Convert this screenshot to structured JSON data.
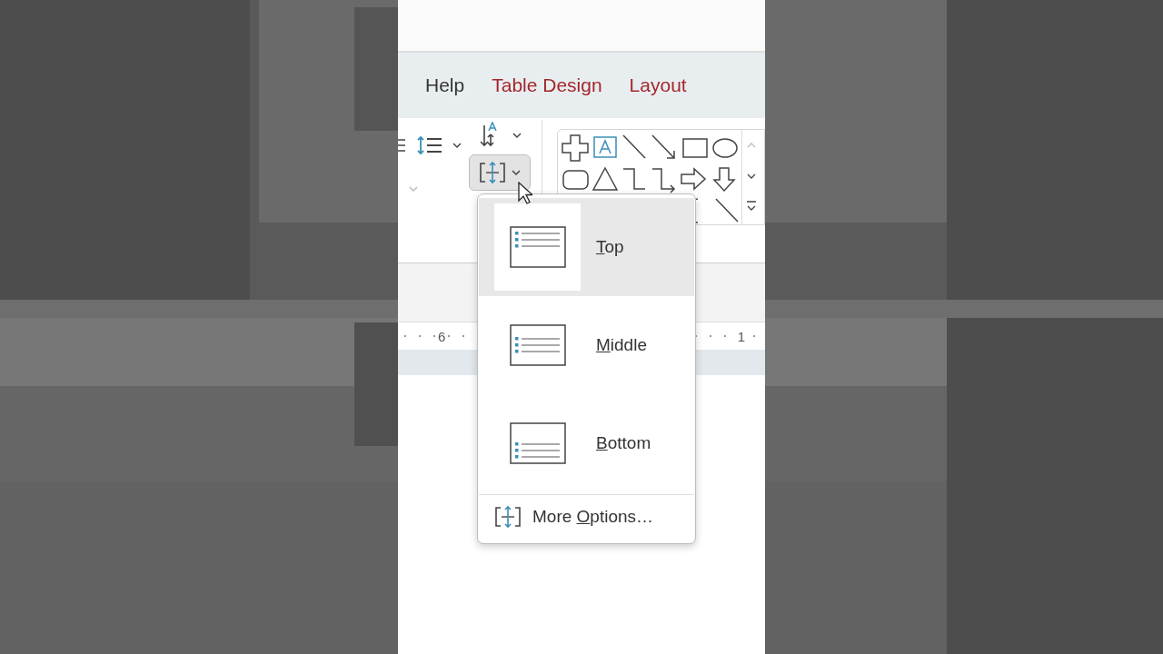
{
  "tabs": [
    {
      "label": "Help",
      "kind": "plain"
    },
    {
      "label": "Table Design",
      "kind": "contextual"
    },
    {
      "label": "Layout",
      "kind": "contextual"
    }
  ],
  "ribbon": {
    "align_button": {
      "pressed": true
    }
  },
  "ruler": {
    "labels": [
      "6",
      "1"
    ]
  },
  "menu": {
    "items": [
      {
        "hotkey": "T",
        "label_rest": "op",
        "kind": "top",
        "selected": true
      },
      {
        "hotkey": "M",
        "label_rest": "iddle",
        "kind": "middle",
        "selected": false
      },
      {
        "hotkey": "B",
        "label_rest": "ottom",
        "kind": "bottom",
        "selected": false
      }
    ],
    "more_options": {
      "label_before": "More ",
      "hotkey": "O",
      "label_rest": "ptions…"
    }
  }
}
